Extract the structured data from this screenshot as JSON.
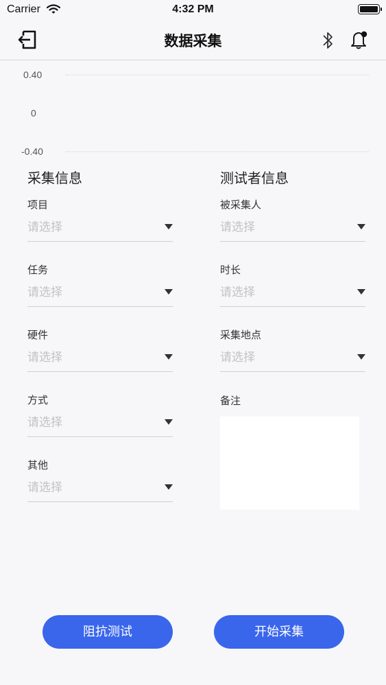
{
  "status_bar": {
    "carrier": "Carrier",
    "time": "4:32 PM",
    "icons": [
      "wifi-icon",
      "battery-icon"
    ]
  },
  "nav": {
    "title": "数据采集",
    "left_icon": "exit-icon",
    "right_icons": [
      "bluetooth-icon",
      "bell-icon"
    ]
  },
  "chart_data": {
    "type": "line",
    "title": "",
    "xlabel": "",
    "ylabel": "",
    "ylim": [
      -0.4,
      0.4
    ],
    "y_ticks": [
      "0.40",
      "0",
      "-0.40"
    ],
    "series": []
  },
  "collection_info": {
    "title": "采集信息",
    "fields": [
      {
        "label": "项目",
        "placeholder": "请选择"
      },
      {
        "label": "任务",
        "placeholder": "请选择"
      },
      {
        "label": "硬件",
        "placeholder": "请选择"
      },
      {
        "label": "方式",
        "placeholder": "请选择"
      },
      {
        "label": "其他",
        "placeholder": "请选择"
      }
    ]
  },
  "tester_info": {
    "title": "测试者信息",
    "fields": [
      {
        "label": "被采集人",
        "placeholder": "请选择"
      },
      {
        "label": "时长",
        "placeholder": "请选择"
      },
      {
        "label": "采集地点",
        "placeholder": "请选择"
      }
    ],
    "remark_label": "备注",
    "remark_value": ""
  },
  "buttons": {
    "impedance": "阻抗测试",
    "start": "开始采集"
  },
  "colors": {
    "accent": "#3a66ec",
    "background": "#f7f7f9",
    "placeholder": "#c2c2c6"
  }
}
